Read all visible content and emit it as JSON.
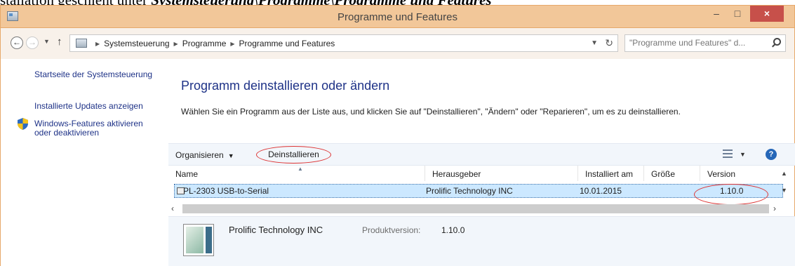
{
  "document": {
    "caption_prefix": "stallation geschieht unter ",
    "caption_bold": "Systemsteuerung\\Programme\\Programme und Features"
  },
  "window": {
    "title": "Programme und Features",
    "minimize": "–",
    "maximize": "□",
    "close": "×"
  },
  "address": {
    "breadcrumbs": [
      "Systemsteuerung",
      "Programme",
      "Programme und Features"
    ],
    "search_placeholder": "\"Programme und Features\" d..."
  },
  "sidebar": {
    "home": "Startseite der Systemsteuerung",
    "updates": "Installierte Updates anzeigen",
    "features": "Windows-Features aktivieren oder deaktivieren"
  },
  "main": {
    "title": "Programm deinstallieren oder ändern",
    "description": "Wählen Sie ein Programm aus der Liste aus, und klicken Sie auf \"Deinstallieren\", \"Ändern\" oder \"Reparieren\", um es zu deinstallieren."
  },
  "toolbar": {
    "organize": "Organisieren",
    "uninstall": "Deinstallieren",
    "help": "?"
  },
  "table": {
    "columns": [
      "Name",
      "Herausgeber",
      "Installiert am",
      "Größe",
      "Version"
    ],
    "rows": [
      {
        "name": "PL-2303 USB-to-Serial",
        "publisher": "Prolific Technology INC",
        "installed": "10.01.2015",
        "size": "",
        "version": "1.10.0"
      }
    ]
  },
  "details": {
    "publisher": "Prolific Technology INC",
    "version_label": "Produktversion:",
    "version_value": "1.10.0"
  },
  "colors": {
    "titlebar": "#f2c799",
    "close_button": "#c7504a",
    "selection": "#cce8ff",
    "link": "#1e3287",
    "annotation_ellipse": "#dd3333"
  }
}
